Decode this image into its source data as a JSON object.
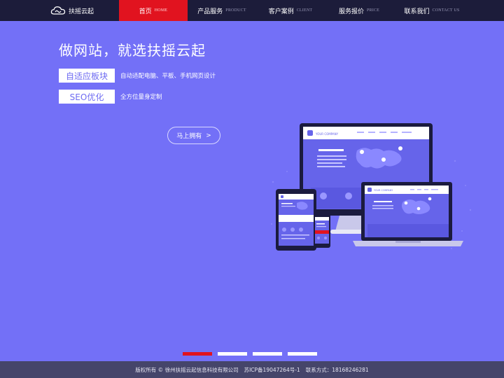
{
  "brand": {
    "name": "扶摇云起"
  },
  "nav": {
    "items": [
      {
        "label": "首页",
        "en": "HOME",
        "active": true
      },
      {
        "label": "产品服务",
        "en": "PRODUCT",
        "active": false
      },
      {
        "label": "客户案例",
        "en": "CLIENT",
        "active": false
      },
      {
        "label": "服务报价",
        "en": "PRICE",
        "active": false
      },
      {
        "label": "联系我们",
        "en": "CONTACT US",
        "active": false
      }
    ]
  },
  "hero": {
    "title": "做网站，就选扶摇云起",
    "features": [
      {
        "tag": "自适应板块",
        "desc": "自动适配电脑、平板、手机网页设计"
      },
      {
        "tag": "SEO优化",
        "desc": "全方位量身定制"
      }
    ],
    "cta_label": "马上拥有",
    "cta_arrow": ">"
  },
  "illustration": {
    "desktop_company": "YOUR COMPANY",
    "laptop_company": "YOUR COMPANY"
  },
  "slider": {
    "count": 4,
    "active_index": 0
  },
  "footer": {
    "copyright": "版权所有 © 徐州扶摇云起信息科技有限公司",
    "icp": "苏ICP备19047264号-1",
    "contact": "联系方式：18168246281"
  },
  "colors": {
    "background": "#7370f7",
    "topbar": "#1c1c3a",
    "accent": "#e1131f",
    "footer": "#45456a"
  }
}
